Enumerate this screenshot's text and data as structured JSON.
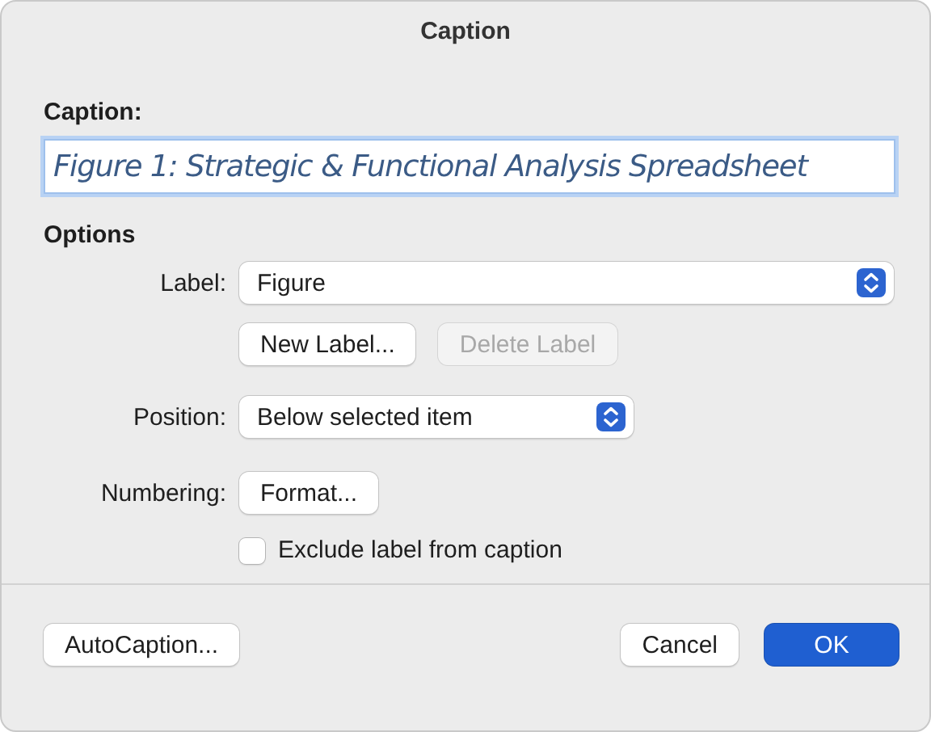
{
  "window": {
    "title": "Caption"
  },
  "caption": {
    "label": "Caption:",
    "value": "Figure 1: Strategic & Functional Analysis Spreadsheet"
  },
  "options": {
    "heading": "Options",
    "label_field": {
      "label": "Label:",
      "value": "Figure"
    },
    "label_buttons": [
      {
        "text": "New Label...",
        "disabled": false
      },
      {
        "text": "Delete Label",
        "disabled": true
      }
    ],
    "position_field": {
      "label": "Position:",
      "value": "Below selected item"
    },
    "numbering": {
      "label": "Numbering:",
      "button": "Format..."
    },
    "exclude": {
      "label": "Exclude label from caption",
      "checked": false
    }
  },
  "buttons": [
    {
      "text": "AutoCaption...",
      "kind": "plain"
    },
    {
      "text": "Cancel",
      "kind": "plain"
    },
    {
      "text": "OK",
      "kind": "default"
    }
  ]
}
